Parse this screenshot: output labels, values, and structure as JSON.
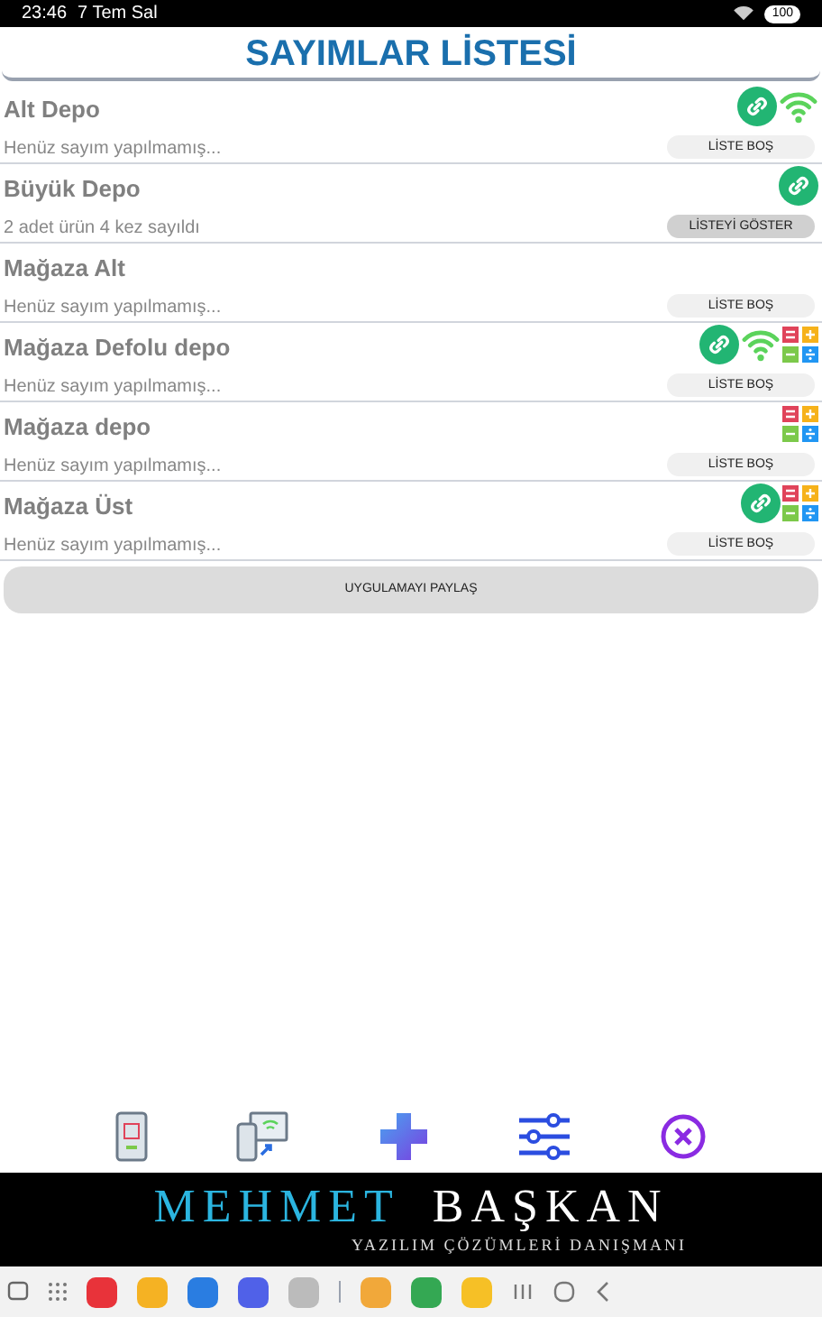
{
  "status_bar": {
    "time": "23:46",
    "date": "7 Tem Sal",
    "battery": "100"
  },
  "title": "SAYIMLAR LİSTESİ",
  "depots": [
    {
      "name": "Alt Depo",
      "status": "Henüz sayım yapılmamış...",
      "button": "LİSTE BOŞ",
      "kind": "empty",
      "linked": true,
      "wifi": true,
      "calculator": false
    },
    {
      "name": "Büyük Depo",
      "status": "2 adet ürün 4 kez sayıldı",
      "button": "LİSTEYİ GÖSTER",
      "kind": "filled",
      "linked": true,
      "wifi": false,
      "calculator": false
    },
    {
      "name": "Mağaza Alt",
      "status": "Henüz sayım yapılmamış...",
      "button": "LİSTE BOŞ",
      "kind": "empty",
      "linked": false,
      "wifi": false,
      "calculator": false
    },
    {
      "name": "Mağaza Defolu depo",
      "status": "Henüz sayım yapılmamış...",
      "button": "LİSTE BOŞ",
      "kind": "empty",
      "linked": true,
      "wifi": true,
      "calculator": true
    },
    {
      "name": "Mağaza depo",
      "status": "Henüz sayım yapılmamış...",
      "button": "LİSTE BOŞ",
      "kind": "empty",
      "linked": false,
      "wifi": false,
      "calculator": true
    },
    {
      "name": "Mağaza Üst",
      "status": "Henüz sayım yapılmamış...",
      "button": "LİSTE BOŞ",
      "kind": "empty",
      "linked": true,
      "wifi": false,
      "calculator": true
    }
  ],
  "share_button": "UYGULAMAYI PAYLAŞ",
  "banner": {
    "name_first": "MEHMET",
    "name_last": "BAŞKAN",
    "subtitle": "YAZILIM ÇÖZÜMLERİ DANIŞMANI"
  }
}
